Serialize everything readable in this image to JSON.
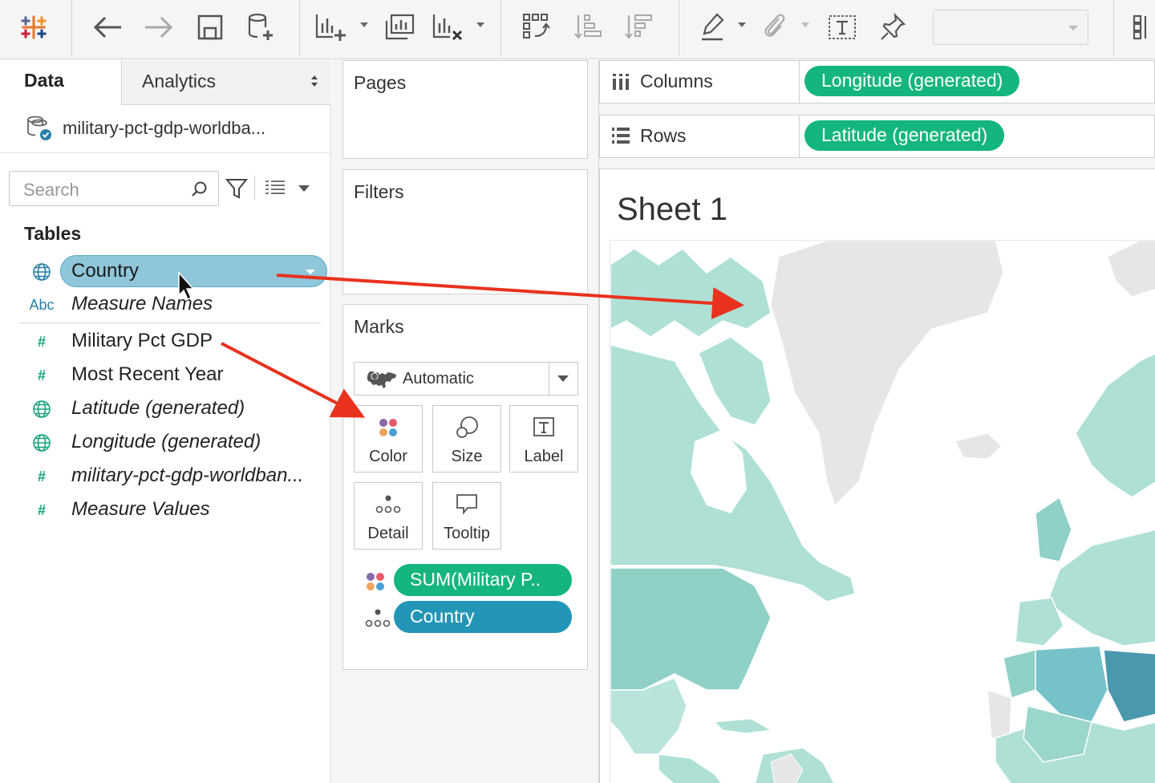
{
  "toolbar": {
    "icons": [
      "tableau-logo-icon",
      "undo-icon",
      "redo-icon",
      "save-icon",
      "new-datasource-icon",
      "new-worksheet-icon",
      "duplicate-sheet-icon",
      "clear-sheet-icon",
      "swap-icon",
      "sort-ascending-icon",
      "sort-descending-icon",
      "highlight-icon",
      "paperclip-icon",
      "text-label-icon",
      "pin-icon",
      "show-me-icon"
    ],
    "fit_select_value": ""
  },
  "data_pane": {
    "tabs": {
      "data": "Data",
      "analytics": "Analytics"
    },
    "datasource": "military-pct-gdp-worldba...",
    "search_placeholder": "Search",
    "tables_heading": "Tables",
    "fields": [
      {
        "type": "geo",
        "type_label": "",
        "name": "Country",
        "italic": false
      },
      {
        "type": "abc",
        "type_label": "Abc",
        "name": "Measure Names",
        "italic": true
      },
      {
        "type": "measure",
        "type_label": "#",
        "name": "Military Pct GDP",
        "italic": false
      },
      {
        "type": "measure",
        "type_label": "#",
        "name": "Most Recent Year",
        "italic": false
      },
      {
        "type": "geo",
        "type_label": "",
        "name": "Latitude (generated)",
        "italic": true
      },
      {
        "type": "geo",
        "type_label": "",
        "name": "Longitude (generated)",
        "italic": true
      },
      {
        "type": "measure",
        "type_label": "#",
        "name": "military-pct-gdp-worldban...",
        "italic": true
      },
      {
        "type": "measure",
        "type_label": "#",
        "name": "Measure Values",
        "italic": true
      }
    ]
  },
  "cards": {
    "pages": "Pages",
    "filters": "Filters",
    "marks": {
      "title": "Marks",
      "mark_type": "Automatic",
      "buttons": [
        "Color",
        "Size",
        "Label",
        "Detail",
        "Tooltip"
      ],
      "pills": [
        {
          "icon": "color-icon",
          "label": "SUM(Military P..",
          "color": "#14b67e"
        },
        {
          "icon": "detail-icon",
          "label": "Country",
          "color": "#2396b7"
        }
      ]
    }
  },
  "shelves": {
    "columns": {
      "label": "Columns",
      "pill": "Longitude (generated)"
    },
    "rows": {
      "label": "Rows",
      "pill": "Latitude (generated)"
    }
  },
  "sheet": {
    "title": "Sheet 1"
  },
  "colors": {
    "measure_green": "#14b67e",
    "dimension_blue": "#2396b7",
    "drag_arrow": "#e8321e",
    "map_light": "#aee0d6",
    "map_medium": "#8fd0c7",
    "map_dark": "#4a98ae",
    "map_no_data": "#e6e6e6"
  }
}
